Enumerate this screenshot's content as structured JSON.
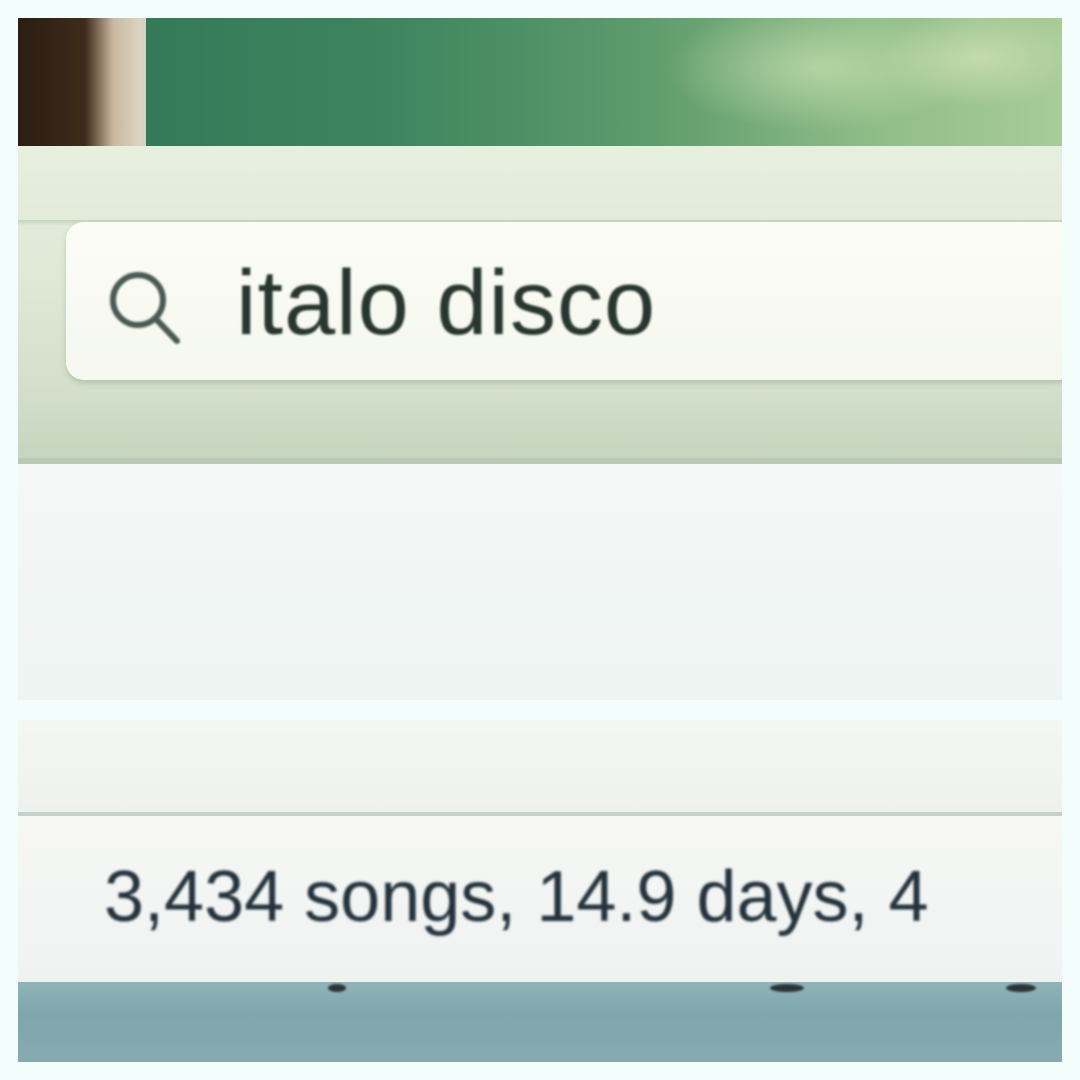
{
  "search": {
    "query": "italo disco"
  },
  "status_bar": {
    "summary": "3,434 songs, 14.9 days, 4"
  }
}
